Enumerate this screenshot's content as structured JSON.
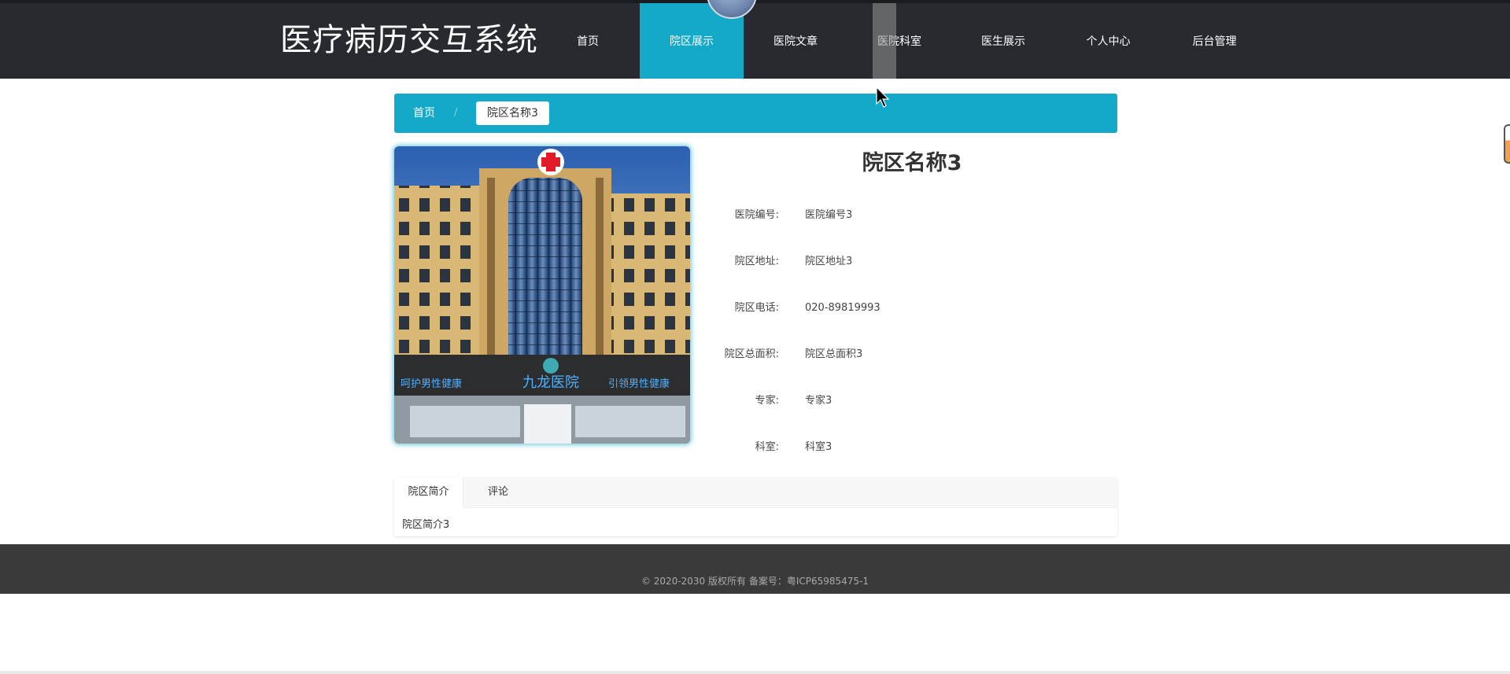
{
  "header": {
    "brand": "医疗病历交互系统",
    "nav": [
      {
        "label": "首页"
      },
      {
        "label": "院区展示"
      },
      {
        "label": "医院文章"
      },
      {
        "label": "医院科室"
      },
      {
        "label": "医生展示"
      },
      {
        "label": "个人中心"
      },
      {
        "label": "后台管理"
      }
    ],
    "active_index": 1,
    "accent_color": "#14a8c9",
    "background_color": "#272b30"
  },
  "breadcrumb": {
    "home": "首页",
    "separator": "/",
    "current": "院区名称3"
  },
  "detail": {
    "image_icon": "hospital-building-photo",
    "image_sign_text": "九龙医院",
    "title": "院区名称3",
    "fields": [
      {
        "label": "医院编号:",
        "value": "医院编号3"
      },
      {
        "label": "院区地址:",
        "value": "院区地址3"
      },
      {
        "label": "院区电话:",
        "value": "020-89819993"
      },
      {
        "label": "院区总面积:",
        "value": "院区总面积3"
      },
      {
        "label": "专家:",
        "value": "专家3"
      },
      {
        "label": "科室:",
        "value": "科室3"
      }
    ]
  },
  "tabs": {
    "items": [
      {
        "label": "院区简介"
      },
      {
        "label": "评论"
      }
    ],
    "active_index": 0,
    "content": "院区简介3"
  },
  "footer": {
    "text": "© 2020-2030 版权所有 备案号：粤ICP65985475-1",
    "background_color": "#3a3a3a"
  }
}
